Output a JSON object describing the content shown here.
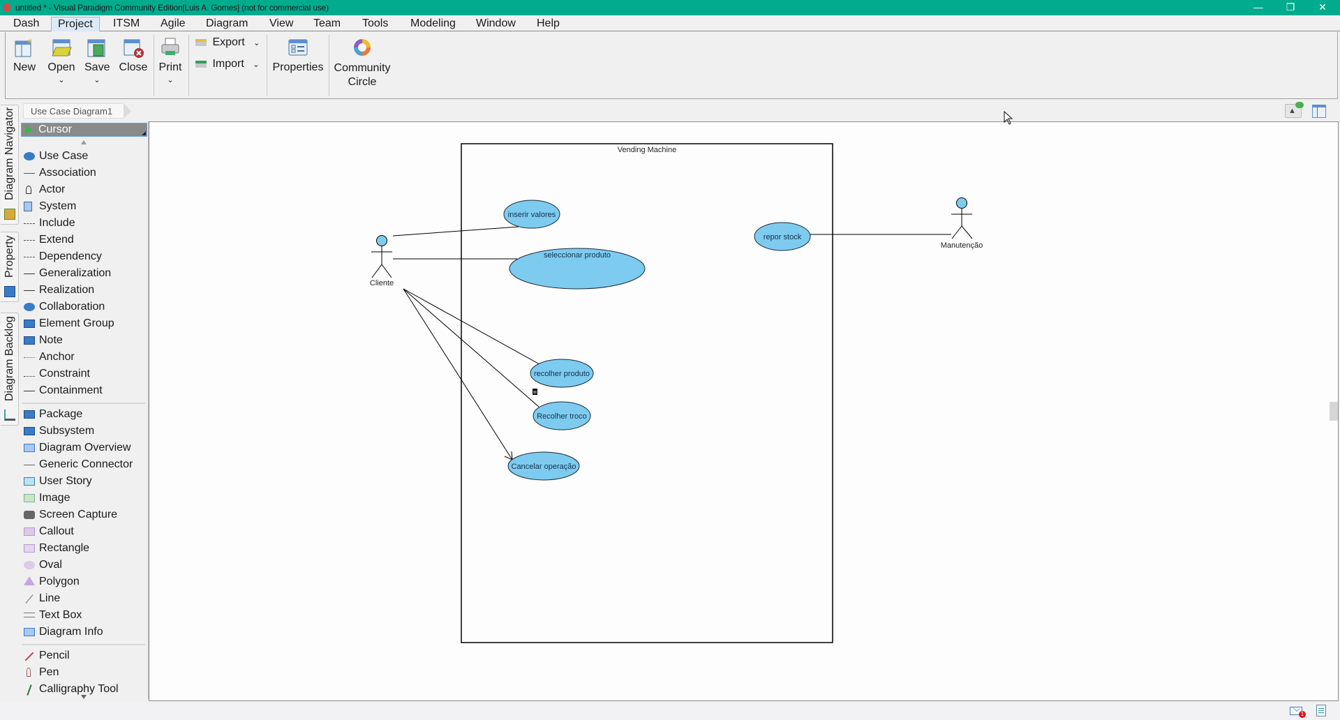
{
  "window": {
    "title": "untitled * - Visual Paradigm Community Edition[Luis A. Gomes] (not for commercial use)",
    "controls": [
      "minimize",
      "restore",
      "close"
    ]
  },
  "menubar": {
    "items": [
      "Dash",
      "Project",
      "ITSM",
      "Agile",
      "Diagram",
      "View",
      "Team",
      "Tools",
      "Modeling",
      "Window",
      "Help"
    ],
    "active": "Project"
  },
  "ribbon": {
    "new": "New",
    "open": "Open",
    "save": "Save",
    "close": "Close",
    "print": "Print",
    "export": "Export",
    "import": "Import",
    "properties": "Properties",
    "community_line1": "Community",
    "community_line2": "Circle"
  },
  "breadcrumb": "Use Case Diagram1",
  "sidetabs": [
    "Diagram Navigator",
    "Property",
    "Diagram Backlog"
  ],
  "palette": {
    "selected": "Cursor",
    "groups": [
      [
        "Use Case",
        "Association",
        "Actor",
        "System",
        "Include",
        "Extend",
        "Dependency",
        "Generalization",
        "Realization",
        "Collaboration",
        "Element Group",
        "Note",
        "Anchor",
        "Constraint",
        "Containment"
      ],
      [
        "Package",
        "Subsystem",
        "Diagram Overview",
        "Generic Connector",
        "User Story",
        "Image",
        "Screen Capture",
        "Callout",
        "Rectangle",
        "Oval",
        "Polygon",
        "Line",
        "Text Box",
        "Diagram Info"
      ],
      [
        "Pencil",
        "Pen",
        "Calligraphy Tool"
      ]
    ]
  },
  "diagram": {
    "system": "Vending Machine",
    "actors": [
      "Cliente",
      "Manutenção"
    ],
    "use_cases": [
      "inserir valores",
      "seleccionar produto",
      "repor stock",
      "recolher produto",
      "Recolher troco",
      "Cancelar operação"
    ],
    "colors": {
      "use_case_fill": "#7ecbf0",
      "actor_head_fill": "#7ecbf0",
      "stroke": "#000000"
    }
  },
  "statusbar": {
    "notification_count": "1"
  },
  "theme": {
    "titlebar": "#00ab8e"
  }
}
